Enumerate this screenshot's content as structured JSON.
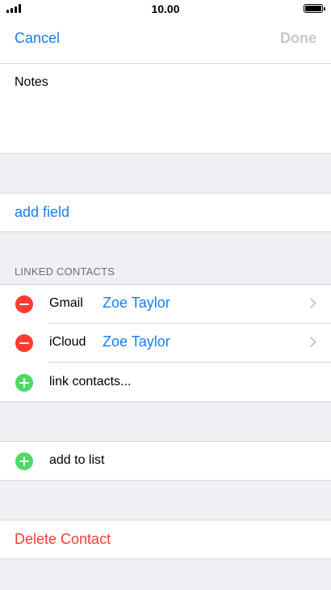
{
  "status_bar": {
    "time": "10.00"
  },
  "nav": {
    "cancel_label": "Cancel",
    "done_label": "Done"
  },
  "notes": {
    "label": "Notes"
  },
  "add_field": {
    "label": "add field"
  },
  "linked_contacts": {
    "header": "LINKED CONTACTS",
    "items": [
      {
        "account": "Gmail",
        "name": "Zoe Taylor"
      },
      {
        "account": "iCloud",
        "name": "Zoe Taylor"
      }
    ],
    "link_label": "link contacts..."
  },
  "add_to_list": {
    "label": "add to list"
  },
  "delete_contact": {
    "label": "Delete Contact"
  },
  "colors": {
    "accent": "#157efb",
    "destructive": "#ff3b30",
    "add": "#4cd964",
    "disabled": "#c7c7cc",
    "background": "#efeff4"
  }
}
